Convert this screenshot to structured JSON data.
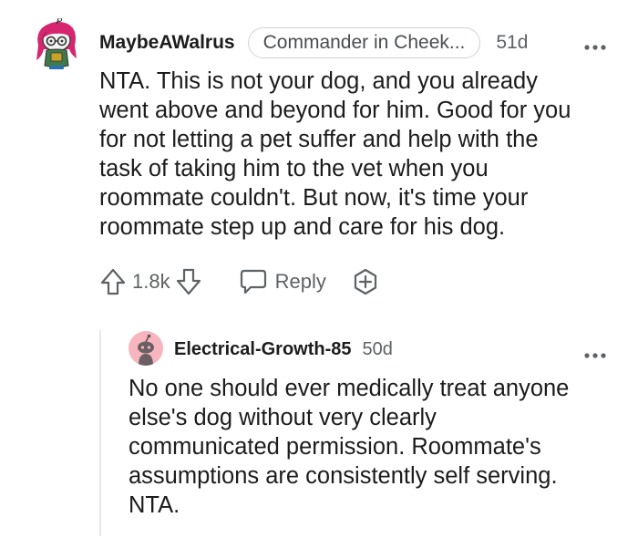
{
  "comments": [
    {
      "username": "MaybeAWalrus",
      "flair": "Commander in Cheek...",
      "age": "51d",
      "more_icon": "more-dots-icon",
      "body": [
        "NTA. This is not your dog, and you already",
        "went above and beyond for him. Good for you",
        "for not letting a pet suffer and help with the",
        "task of taking him to the vet when you",
        "roommate couldn't. But now, it's time your",
        "roommate step up and care for his dog."
      ],
      "votes": "1.8k",
      "reply_label": "Reply",
      "icons": [
        "upvote-icon",
        "downvote-icon",
        "reply-bubble-icon",
        "award-icon"
      ]
    },
    {
      "username": "Electrical-Growth-85",
      "age": "50d",
      "more_icon": "more-dots-icon",
      "body": [
        "No one should ever medically treat anyone",
        "else's dog without very clearly",
        "communicated permission. Roommate's",
        "assumptions are consistently self serving.",
        "NTA."
      ]
    }
  ],
  "colors": {
    "text": "#1c1c1c",
    "meta": "#5e6265",
    "flair_border": "#cfd3d6",
    "thread_line": "#e6e8ea",
    "avatar2_bg": "#f7b6bf",
    "avatar1_hair": "#d6266f"
  }
}
